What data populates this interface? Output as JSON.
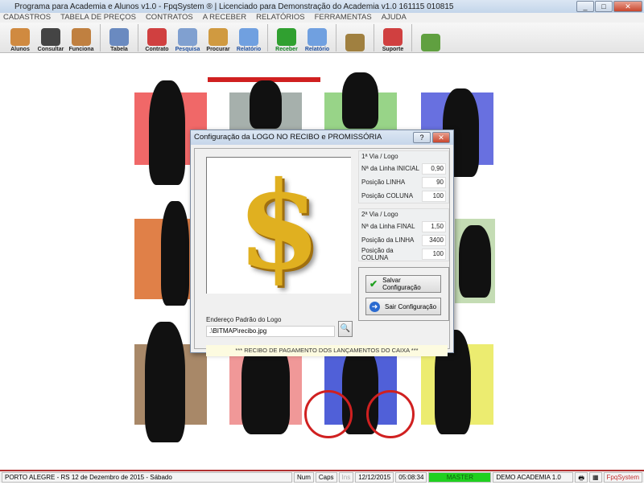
{
  "window": {
    "title": "Programa para Academia e Alunos v1.0 - FpqSystem ® | Licenciado para  Demonstração do Academia v1.0 161115 010815"
  },
  "menu": [
    "CADASTROS",
    "TABELA DE PREÇOS",
    "CONTRATOS",
    "A RECEBER",
    "RELATÓRIOS",
    "FERRAMENTAS",
    "AJUDA"
  ],
  "toolbar": [
    {
      "label": "Alunos",
      "color": "#d08a40"
    },
    {
      "label": "Consultar",
      "color": "#444"
    },
    {
      "label": "Funciona",
      "color": "#c08040"
    },
    {
      "label": "Tabela",
      "color": "#6a8ac0"
    },
    {
      "label": "Contrato",
      "color": "#d04040"
    },
    {
      "label": "Pesquisa",
      "color": "#80a0d0"
    },
    {
      "label": "Procurar",
      "color": "#d09a40"
    },
    {
      "label": "Relatório",
      "color": "#70a0e0"
    },
    {
      "label": "Receber",
      "color": "#30a030"
    },
    {
      "label": "Relatório",
      "color": "#70a0e0"
    },
    {
      "label": "",
      "color": "#a08040"
    },
    {
      "label": "Suporte",
      "color": "#d04040"
    },
    {
      "label": "",
      "color": "#60a040"
    }
  ],
  "dialog": {
    "title": "Configuração da LOGO NO RECIBO e PROMISSÓRIA",
    "logo_symbol": "$",
    "via1": {
      "label": "1ª Via / Logo",
      "fields": [
        {
          "label": "Nª da Linha INICIAL",
          "value": "0,90"
        },
        {
          "label": "Posição LINHA",
          "value": "90"
        },
        {
          "label": "Posição COLUNA",
          "value": "100"
        }
      ]
    },
    "via2": {
      "label": "2ª Via / Logo",
      "fields": [
        {
          "label": "Nª da Linha FINAL",
          "value": "1,50"
        },
        {
          "label": "Posição da LINHA",
          "value": "3400"
        },
        {
          "label": "Posição da COLUNA",
          "value": "100"
        }
      ]
    },
    "save_label": "Salvar Configuração",
    "exit_label": "Sair Configuração",
    "path_label": "Endereço Padrão do Logo",
    "path_value": ".\\BITMAP\\recibo.jpg",
    "note": "*** RECIBO DE PAGAMENTO DOS LANÇAMENTOS DO CAIXA ***"
  },
  "status": {
    "location": "PORTO ALEGRE - RS 12 de Dezembro de 2015 - Sábado",
    "num": "Num",
    "caps": "Caps",
    "ins": "Ins",
    "date": "12/12/2015",
    "time": "05:08:34",
    "user": "MASTER",
    "company": "DEMO ACADEMIA 1.0",
    "brand": "FpqSystem"
  }
}
